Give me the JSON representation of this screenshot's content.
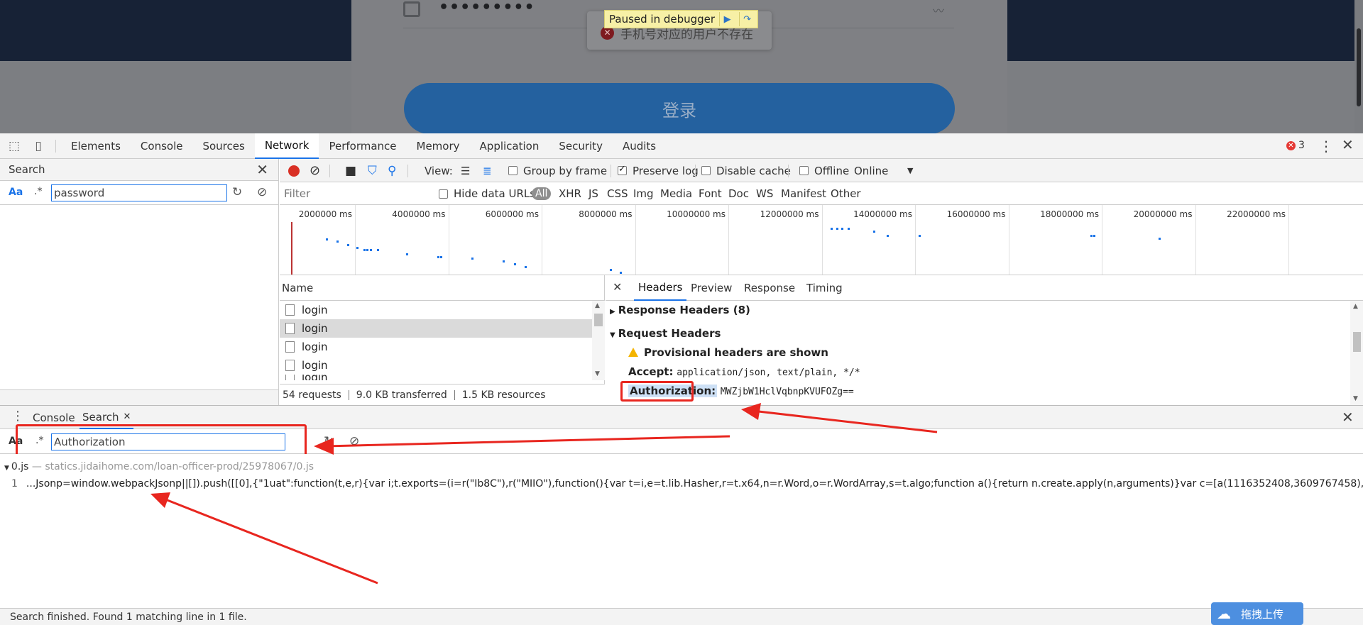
{
  "page": {
    "password_dots": "•••••••••",
    "toast_message": "手机号对应的用户不存在",
    "debugger_label": "Paused in debugger",
    "login_button": "登录"
  },
  "devtools": {
    "tabs": [
      "Elements",
      "Console",
      "Sources",
      "Network",
      "Performance",
      "Memory",
      "Application",
      "Security",
      "Audits"
    ],
    "active_tab": "Network",
    "error_count": "3"
  },
  "search_panel": {
    "title": "Search",
    "case_toggle": "Aa",
    "regex_toggle": ".*",
    "query": "password"
  },
  "network_toolbar": {
    "view_label": "View:",
    "group_by_frame": "Group by frame",
    "preserve_log": "Preserve log",
    "disable_cache": "Disable cache",
    "offline": "Offline",
    "throttle": "Online"
  },
  "filter_row": {
    "placeholder": "Filter",
    "hide_data_urls": "Hide data URLs",
    "types": [
      "All",
      "XHR",
      "JS",
      "CSS",
      "Img",
      "Media",
      "Font",
      "Doc",
      "WS",
      "Manifest",
      "Other"
    ]
  },
  "timeline": {
    "ticks": [
      "2000000 ms",
      "4000000 ms",
      "6000000 ms",
      "8000000 ms",
      "10000000 ms",
      "12000000 ms",
      "14000000 ms",
      "16000000 ms",
      "18000000 ms",
      "20000000 ms",
      "22000000 ms",
      "240"
    ]
  },
  "requests": {
    "column": "Name",
    "rows": [
      "login",
      "login",
      "login",
      "login",
      "login"
    ],
    "status": {
      "requests": "54 requests",
      "transferred": "9.0 KB transferred",
      "resources": "1.5 KB resources"
    }
  },
  "detail": {
    "tabs": [
      "Headers",
      "Preview",
      "Response",
      "Timing"
    ],
    "response_headers": "Response Headers (8)",
    "request_headers": "Request Headers",
    "provisional": "Provisional headers are shown",
    "accept_key": "Accept:",
    "accept_value": "application/json, text/plain, */*",
    "auth_key": "Authorization:",
    "auth_value": "MWZjbW1HclVqbnpKVUFOZg=="
  },
  "drawer": {
    "tabs": [
      "Console",
      "Search"
    ],
    "case_toggle": "Aa",
    "regex_toggle": ".*",
    "query": "Authorization",
    "result_file": "0.js",
    "result_url": "— statics.jidaihome.com/loan-officer-prod/25978067/0.js",
    "result_line_number": "1",
    "result_line": "...Jsonp=window.webpackJsonp||[]).push([[0],{\"1uat\":function(t,e,r){var i;t.exports=(i=r(\"Ib8C\"),r(\"MIIO\"),function(){var t=i,e=t.lib.Hasher,r=t.x64,n=r.Word,o=r.WordArray,s=t.algo;function a(){return n.create.apply(n,arguments)}var c=[a(1116352408,3609767458),a(1899447441,60289172...",
    "status": "Search finished.  Found 1 matching line in 1 file.",
    "upload_button": "拖拽上传"
  },
  "colors": {
    "accent": "#1a73e8",
    "annotation": "#e8261f",
    "record": "#d93025"
  }
}
